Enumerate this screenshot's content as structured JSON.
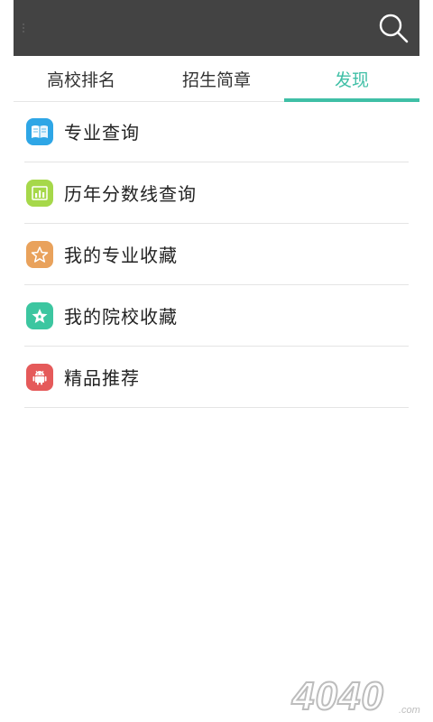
{
  "header": {
    "search_icon": "search-icon",
    "background": "#434343"
  },
  "tabs": [
    {
      "label": "高校排名",
      "active": false
    },
    {
      "label": "招生简章",
      "active": false
    },
    {
      "label": "发现",
      "active": true
    }
  ],
  "accent_color": "#3fbfa6",
  "menu": [
    {
      "label": "专业查询",
      "icon": "book-icon",
      "color": "#2ea6e6"
    },
    {
      "label": "历年分数线查询",
      "icon": "chart-icon",
      "color": "#a6d84a"
    },
    {
      "label": "我的专业收藏",
      "icon": "star-outline-icon",
      "color": "#e9a25c"
    },
    {
      "label": "我的院校收藏",
      "icon": "star-filled-icon",
      "color": "#3cc6a0"
    },
    {
      "label": "精品推荐",
      "icon": "android-icon",
      "color": "#e55a5a"
    }
  ],
  "watermark": {
    "text": "4040",
    "suffix": ".com"
  }
}
